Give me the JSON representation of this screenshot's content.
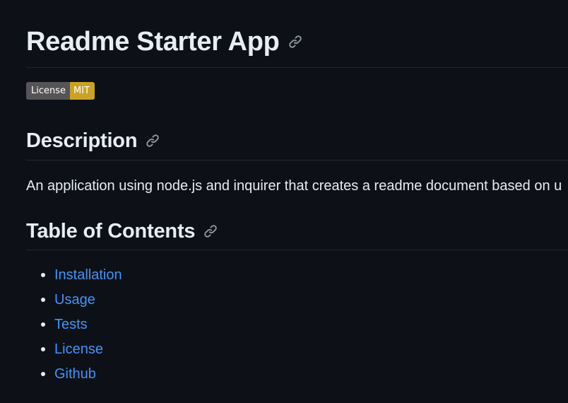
{
  "document": {
    "title": "Readme Starter App",
    "badge": {
      "label": "License",
      "value": "MIT",
      "label_color": "#555555",
      "value_color": "#c9a227"
    },
    "sections": {
      "description": {
        "heading": "Description",
        "text": "An application using node.js and inquirer that creates a readme document based on u"
      },
      "toc": {
        "heading": "Table of Contents",
        "items": [
          {
            "label": "Installation"
          },
          {
            "label": "Usage"
          },
          {
            "label": "Tests"
          },
          {
            "label": "License"
          },
          {
            "label": "Github"
          }
        ]
      }
    }
  },
  "icons": {
    "heading_anchor": "link-icon"
  },
  "colors": {
    "background": "#0d1117",
    "text": "#e6edf3",
    "link": "#4493f8",
    "divider": "#21262d"
  }
}
